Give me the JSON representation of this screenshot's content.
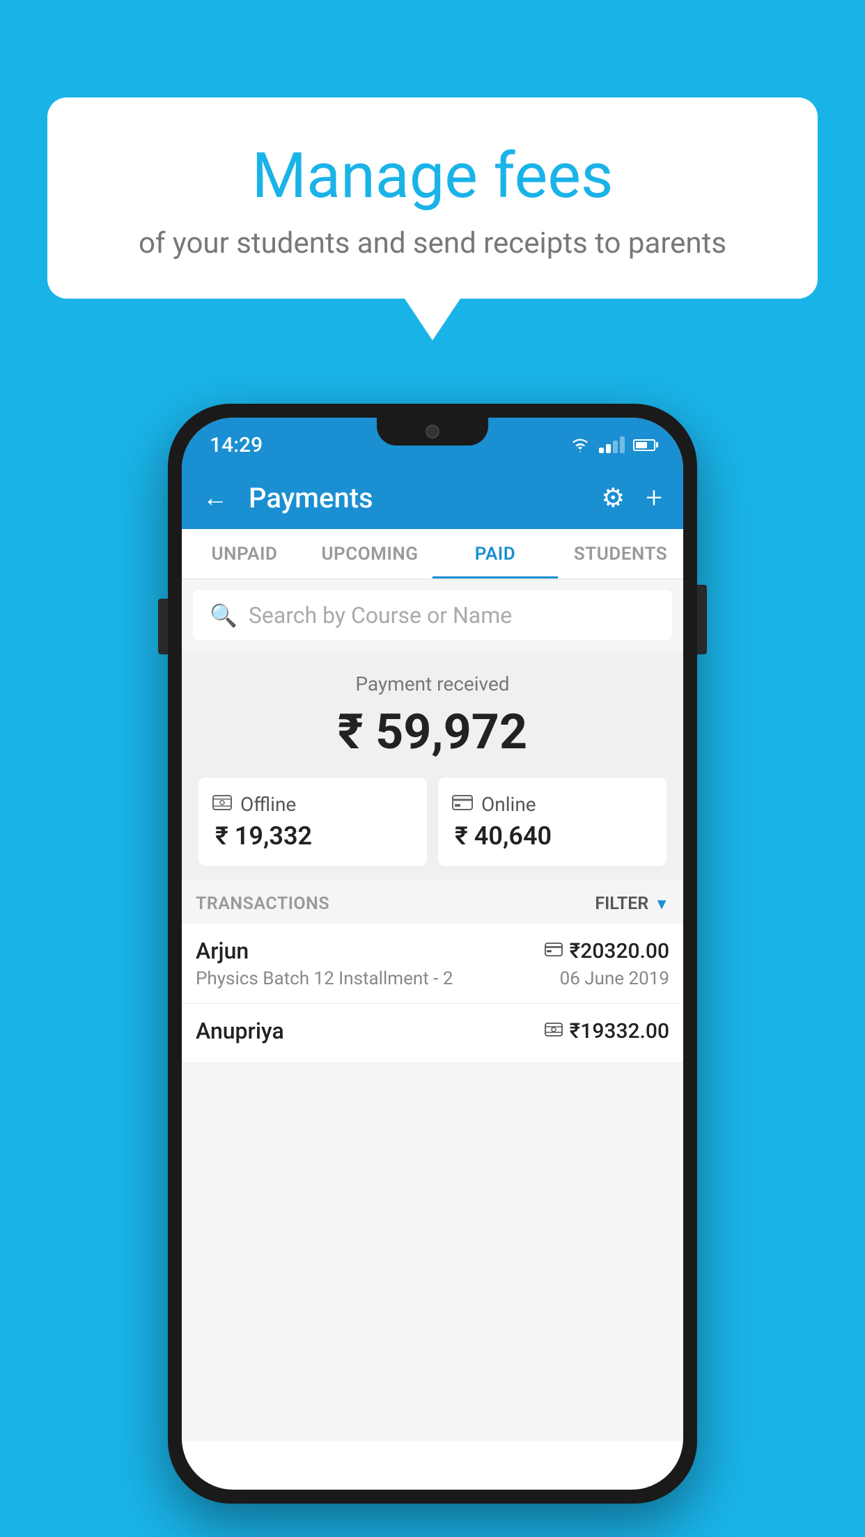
{
  "background_color": "#1ab3e8",
  "speech_bubble": {
    "title": "Manage fees",
    "subtitle": "of your students and send receipts to parents"
  },
  "status_bar": {
    "time": "14:29"
  },
  "app_bar": {
    "title": "Payments",
    "back_label": "←",
    "settings_label": "⚙",
    "add_label": "+"
  },
  "tabs": [
    {
      "label": "UNPAID",
      "active": false
    },
    {
      "label": "UPCOMING",
      "active": false
    },
    {
      "label": "PAID",
      "active": true
    },
    {
      "label": "STUDENTS",
      "active": false
    }
  ],
  "search": {
    "placeholder": "Search by Course or Name"
  },
  "payment_summary": {
    "label": "Payment received",
    "amount": "₹ 59,972",
    "offline": {
      "type": "Offline",
      "amount": "₹ 19,332"
    },
    "online": {
      "type": "Online",
      "amount": "₹ 40,640"
    }
  },
  "transactions": {
    "label": "TRANSACTIONS",
    "filter_label": "FILTER",
    "items": [
      {
        "name": "Arjun",
        "course": "Physics Batch 12 Installment - 2",
        "amount": "₹20320.00",
        "date": "06 June 2019",
        "payment_type": "card"
      },
      {
        "name": "Anupriya",
        "course": "",
        "amount": "₹19332.00",
        "date": "",
        "payment_type": "cash"
      }
    ]
  }
}
